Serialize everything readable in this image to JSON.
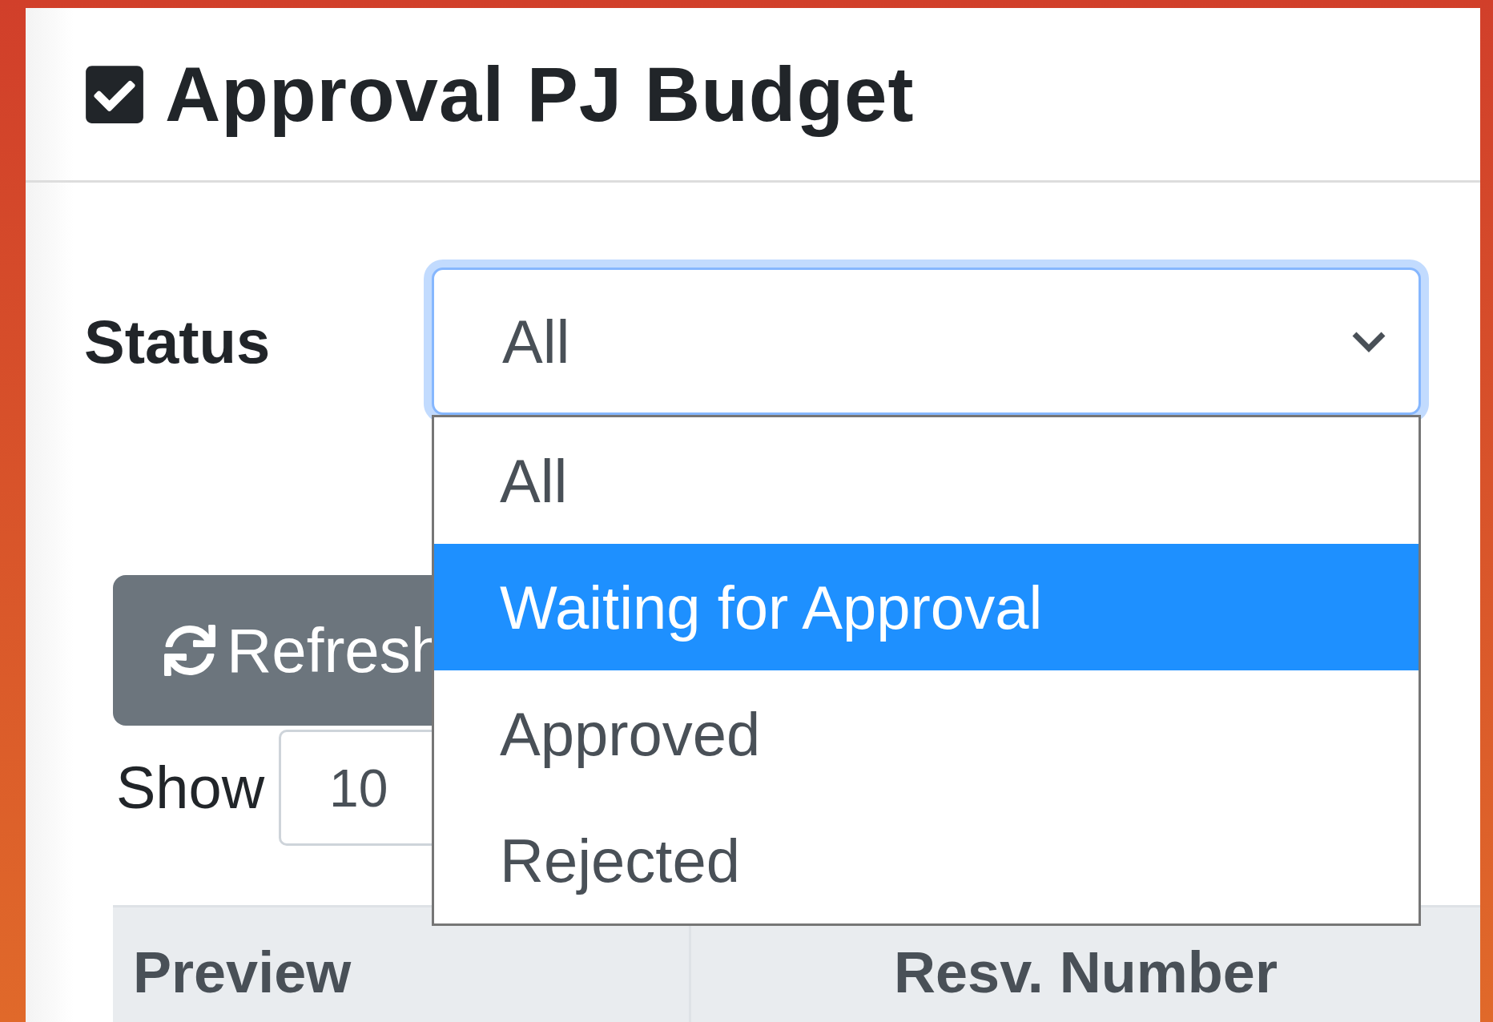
{
  "page": {
    "title": "Approval PJ Budget"
  },
  "filter": {
    "label": "Status",
    "value": "All",
    "expanded": true,
    "options": [
      {
        "label": "All",
        "highlighted": false
      },
      {
        "label": "Waiting for Approval",
        "highlighted": true
      },
      {
        "label": "Approved",
        "highlighted": false
      },
      {
        "label": "Rejected",
        "highlighted": false
      }
    ]
  },
  "refresh_button": {
    "label": "Refresh"
  },
  "page_length": {
    "label": "Show",
    "value": "10"
  },
  "table": {
    "columns": [
      "Preview",
      "Resv. Number"
    ]
  }
}
